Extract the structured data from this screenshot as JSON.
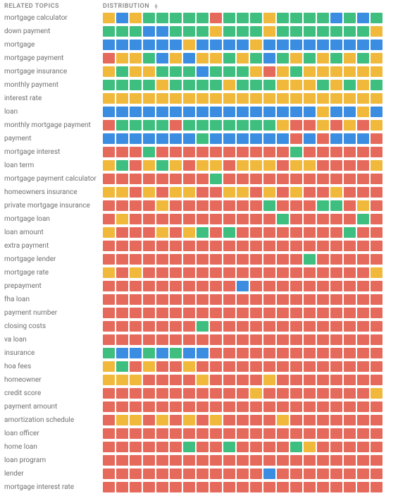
{
  "header": {
    "topics": "RELATED TOPICS",
    "distribution": "DISTRIBUTION"
  },
  "colors": {
    "g": "c-g",
    "y": "c-y",
    "b": "c-b",
    "r": "c-r"
  },
  "chart_data": {
    "type": "heatmap",
    "legend": {
      "g": "green",
      "y": "yellow",
      "b": "blue",
      "r": "red"
    },
    "columns": 21,
    "rows": [
      {
        "label": "mortgage calculator",
        "cells": [
          "y",
          "b",
          "y",
          "g",
          "g",
          "g",
          "g",
          "g",
          "r",
          "g",
          "g",
          "g",
          "y",
          "g",
          "g",
          "g",
          "g",
          "b",
          "g",
          "b",
          "g"
        ]
      },
      {
        "label": "down payment",
        "cells": [
          "g",
          "g",
          "g",
          "b",
          "b",
          "g",
          "g",
          "g",
          "y",
          "g",
          "g",
          "g",
          "y",
          "g",
          "g",
          "g",
          "g",
          "g",
          "g",
          "g",
          "y"
        ]
      },
      {
        "label": "mortgage",
        "cells": [
          "b",
          "b",
          "b",
          "b",
          "b",
          "b",
          "y",
          "b",
          "b",
          "b",
          "b",
          "y",
          "b",
          "b",
          "b",
          "b",
          "b",
          "b",
          "b",
          "b",
          "b"
        ]
      },
      {
        "label": "mortgage payment",
        "cells": [
          "r",
          "y",
          "y",
          "g",
          "b",
          "y",
          "b",
          "y",
          "y",
          "g",
          "y",
          "g",
          "b",
          "g",
          "y",
          "g",
          "y",
          "g",
          "y",
          "g",
          "y"
        ]
      },
      {
        "label": "mortgage insurance",
        "cells": [
          "y",
          "g",
          "y",
          "y",
          "g",
          "g",
          "g",
          "b",
          "g",
          "g",
          "g",
          "y",
          "r",
          "y",
          "g",
          "y",
          "y",
          "y",
          "y",
          "y",
          "y"
        ]
      },
      {
        "label": "monthly payment",
        "cells": [
          "g",
          "g",
          "g",
          "g",
          "y",
          "g",
          "g",
          "g",
          "g",
          "y",
          "g",
          "g",
          "g",
          "y",
          "y",
          "y",
          "g",
          "y",
          "g",
          "y",
          "g"
        ]
      },
      {
        "label": "interest rate",
        "cells": [
          "y",
          "y",
          "y",
          "y",
          "y",
          "y",
          "y",
          "y",
          "y",
          "y",
          "y",
          "y",
          "y",
          "y",
          "y",
          "y",
          "y",
          "y",
          "y",
          "y",
          "y"
        ]
      },
      {
        "label": "loan",
        "cells": [
          "b",
          "b",
          "b",
          "b",
          "b",
          "b",
          "b",
          "b",
          "b",
          "b",
          "b",
          "b",
          "b",
          "b",
          "b",
          "b",
          "y",
          "b",
          "b",
          "y",
          "b"
        ]
      },
      {
        "label": "monthly mortgage payment",
        "cells": [
          "r",
          "g",
          "g",
          "g",
          "g",
          "r",
          "g",
          "g",
          "g",
          "g",
          "g",
          "g",
          "g",
          "y",
          "r",
          "r",
          "y",
          "r",
          "y",
          "r",
          "y"
        ]
      },
      {
        "label": "payment",
        "cells": [
          "b",
          "b",
          "b",
          "b",
          "b",
          "b",
          "b",
          "g",
          "b",
          "b",
          "b",
          "b",
          "b",
          "b",
          "r",
          "b",
          "r",
          "b",
          "b",
          "b",
          "r"
        ]
      },
      {
        "label": "mortgage interest",
        "cells": [
          "r",
          "r",
          "r",
          "g",
          "r",
          "r",
          "r",
          "r",
          "r",
          "r",
          "r",
          "r",
          "r",
          "r",
          "g",
          "r",
          "r",
          "r",
          "r",
          "r",
          "r"
        ]
      },
      {
        "label": "loan term",
        "cells": [
          "y",
          "g",
          "r",
          "y",
          "g",
          "y",
          "r",
          "y",
          "y",
          "r",
          "y",
          "y",
          "y",
          "r",
          "y",
          "y",
          "r",
          "r",
          "r",
          "r",
          "y"
        ]
      },
      {
        "label": "mortgage payment calculator",
        "cells": [
          "r",
          "r",
          "r",
          "r",
          "r",
          "r",
          "r",
          "r",
          "g",
          "r",
          "r",
          "r",
          "r",
          "r",
          "r",
          "r",
          "r",
          "r",
          "r",
          "r",
          "r"
        ]
      },
      {
        "label": "homeowners insurance",
        "cells": [
          "y",
          "y",
          "r",
          "y",
          "r",
          "y",
          "y",
          "r",
          "r",
          "y",
          "y",
          "r",
          "y",
          "r",
          "y",
          "r",
          "r",
          "y",
          "r",
          "r",
          "r"
        ]
      },
      {
        "label": "private mortgage insurance",
        "cells": [
          "r",
          "r",
          "r",
          "r",
          "y",
          "r",
          "r",
          "r",
          "r",
          "r",
          "r",
          "r",
          "g",
          "r",
          "r",
          "r",
          "g",
          "g",
          "r",
          "y",
          "r"
        ]
      },
      {
        "label": "mortgage loan",
        "cells": [
          "r",
          "y",
          "r",
          "r",
          "r",
          "r",
          "r",
          "r",
          "r",
          "r",
          "r",
          "r",
          "r",
          "g",
          "r",
          "r",
          "r",
          "r",
          "r",
          "g",
          "r"
        ]
      },
      {
        "label": "loan amount",
        "cells": [
          "y",
          "r",
          "r",
          "r",
          "y",
          "r",
          "y",
          "g",
          "r",
          "g",
          "r",
          "r",
          "r",
          "r",
          "r",
          "r",
          "r",
          "r",
          "g",
          "r",
          "r"
        ]
      },
      {
        "label": "extra payment",
        "cells": [
          "r",
          "r",
          "r",
          "r",
          "r",
          "r",
          "r",
          "r",
          "r",
          "r",
          "r",
          "r",
          "r",
          "r",
          "r",
          "r",
          "r",
          "r",
          "r",
          "r",
          "r"
        ]
      },
      {
        "label": "mortgage lender",
        "cells": [
          "r",
          "r",
          "r",
          "r",
          "r",
          "r",
          "r",
          "r",
          "r",
          "r",
          "r",
          "r",
          "r",
          "r",
          "r",
          "g",
          "r",
          "r",
          "r",
          "r",
          "r"
        ]
      },
      {
        "label": "mortgage rate",
        "cells": [
          "y",
          "r",
          "y",
          "r",
          "r",
          "r",
          "r",
          "r",
          "r",
          "r",
          "r",
          "r",
          "r",
          "r",
          "r",
          "r",
          "r",
          "r",
          "r",
          "r",
          "y"
        ]
      },
      {
        "label": "prepayment",
        "cells": [
          "r",
          "r",
          "r",
          "r",
          "r",
          "r",
          "r",
          "r",
          "r",
          "r",
          "b",
          "r",
          "r",
          "r",
          "r",
          "r",
          "r",
          "r",
          "r",
          "r",
          "r"
        ]
      },
      {
        "label": "fha loan",
        "cells": [
          "r",
          "r",
          "r",
          "r",
          "r",
          "r",
          "r",
          "r",
          "r",
          "r",
          "r",
          "r",
          "r",
          "r",
          "r",
          "r",
          "r",
          "r",
          "r",
          "r",
          "r"
        ]
      },
      {
        "label": "payment number",
        "cells": [
          "r",
          "r",
          "r",
          "r",
          "r",
          "r",
          "r",
          "r",
          "r",
          "r",
          "r",
          "r",
          "r",
          "r",
          "r",
          "r",
          "r",
          "r",
          "r",
          "r",
          "r"
        ]
      },
      {
        "label": "closing costs",
        "cells": [
          "r",
          "r",
          "r",
          "r",
          "r",
          "r",
          "r",
          "g",
          "r",
          "r",
          "r",
          "r",
          "r",
          "r",
          "r",
          "r",
          "r",
          "r",
          "r",
          "r",
          "r"
        ]
      },
      {
        "label": "va loan",
        "cells": [
          "r",
          "r",
          "r",
          "r",
          "r",
          "r",
          "r",
          "r",
          "r",
          "r",
          "r",
          "r",
          "r",
          "r",
          "r",
          "r",
          "r",
          "r",
          "r",
          "r",
          "r"
        ]
      },
      {
        "label": "insurance",
        "cells": [
          "g",
          "b",
          "b",
          "g",
          "b",
          "g",
          "b",
          "b",
          "r",
          "r",
          "r",
          "r",
          "r",
          "r",
          "r",
          "r",
          "r",
          "r",
          "r",
          "r",
          "r"
        ]
      },
      {
        "label": "hoa fees",
        "cells": [
          "y",
          "g",
          "r",
          "y",
          "r",
          "r",
          "y",
          "r",
          "r",
          "r",
          "r",
          "r",
          "r",
          "r",
          "r",
          "r",
          "r",
          "r",
          "r",
          "r",
          "r"
        ]
      },
      {
        "label": "homeowner",
        "cells": [
          "y",
          "y",
          "y",
          "r",
          "r",
          "r",
          "r",
          "y",
          "r",
          "r",
          "r",
          "r",
          "y",
          "r",
          "r",
          "r",
          "r",
          "r",
          "r",
          "r",
          "r"
        ]
      },
      {
        "label": "credit score",
        "cells": [
          "r",
          "r",
          "r",
          "r",
          "r",
          "r",
          "r",
          "r",
          "r",
          "r",
          "r",
          "y",
          "r",
          "r",
          "r",
          "r",
          "r",
          "r",
          "r",
          "r",
          "y"
        ]
      },
      {
        "label": "payment amount",
        "cells": [
          "r",
          "r",
          "r",
          "r",
          "r",
          "r",
          "r",
          "r",
          "r",
          "r",
          "r",
          "r",
          "r",
          "r",
          "r",
          "r",
          "r",
          "r",
          "r",
          "r",
          "r"
        ]
      },
      {
        "label": "amortization schedule",
        "cells": [
          "r",
          "y",
          "y",
          "r",
          "y",
          "r",
          "y",
          "r",
          "y",
          "r",
          "r",
          "r",
          "r",
          "y",
          "r",
          "r",
          "r",
          "r",
          "r",
          "r",
          "r"
        ]
      },
      {
        "label": "loan officer",
        "cells": [
          "r",
          "r",
          "r",
          "r",
          "r",
          "r",
          "r",
          "r",
          "r",
          "r",
          "r",
          "r",
          "r",
          "r",
          "r",
          "r",
          "r",
          "r",
          "r",
          "r",
          "r"
        ]
      },
      {
        "label": "home loan",
        "cells": [
          "r",
          "r",
          "r",
          "r",
          "r",
          "r",
          "g",
          "r",
          "r",
          "g",
          "r",
          "r",
          "r",
          "r",
          "g",
          "y",
          "r",
          "r",
          "r",
          "r",
          "r"
        ]
      },
      {
        "label": "loan program",
        "cells": [
          "r",
          "r",
          "r",
          "r",
          "r",
          "r",
          "r",
          "r",
          "r",
          "r",
          "r",
          "r",
          "r",
          "r",
          "r",
          "r",
          "r",
          "r",
          "r",
          "r",
          "r"
        ]
      },
      {
        "label": "lender",
        "cells": [
          "r",
          "r",
          "r",
          "r",
          "r",
          "r",
          "r",
          "r",
          "r",
          "r",
          "r",
          "r",
          "b",
          "r",
          "r",
          "r",
          "r",
          "r",
          "r",
          "r",
          "r"
        ]
      },
      {
        "label": "mortgage interest rate",
        "cells": [
          "r",
          "r",
          "r",
          "r",
          "r",
          "r",
          "r",
          "r",
          "r",
          "r",
          "r",
          "r",
          "r",
          "r",
          "r",
          "r",
          "r",
          "r",
          "r",
          "r",
          "r"
        ]
      }
    ]
  }
}
